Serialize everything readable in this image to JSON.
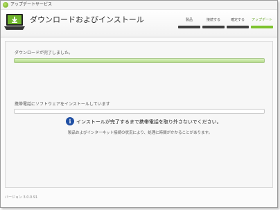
{
  "window": {
    "title": "アップデートサービス"
  },
  "header": {
    "title": "ダウンロードおよびインストール",
    "steps": [
      {
        "label": "製品",
        "active": false
      },
      {
        "label": "接続する",
        "active": false
      },
      {
        "label": "確定する",
        "active": false
      },
      {
        "label": "アップデート",
        "active": true
      }
    ],
    "icon": "laptop-download-icon"
  },
  "main": {
    "download_status": "ダウンロードが完了しました。",
    "download_progress": 1.0,
    "install_status": "携帯電話にソフトウェアをインストールしています",
    "install_progress": 0.0,
    "warning_text": "インストールが完了するまで携帯電話を取り外さないでください。",
    "note_text": "製品およびインターネット接続の状況により、処理に時間がかかることがあります。",
    "info_icon": "i"
  },
  "footer": {
    "version": "バージョン 3.0.0.91"
  },
  "colors": {
    "accent": "#7dc22e",
    "inactive_step": "#3f3f3f",
    "info": "#1f4fa3"
  }
}
